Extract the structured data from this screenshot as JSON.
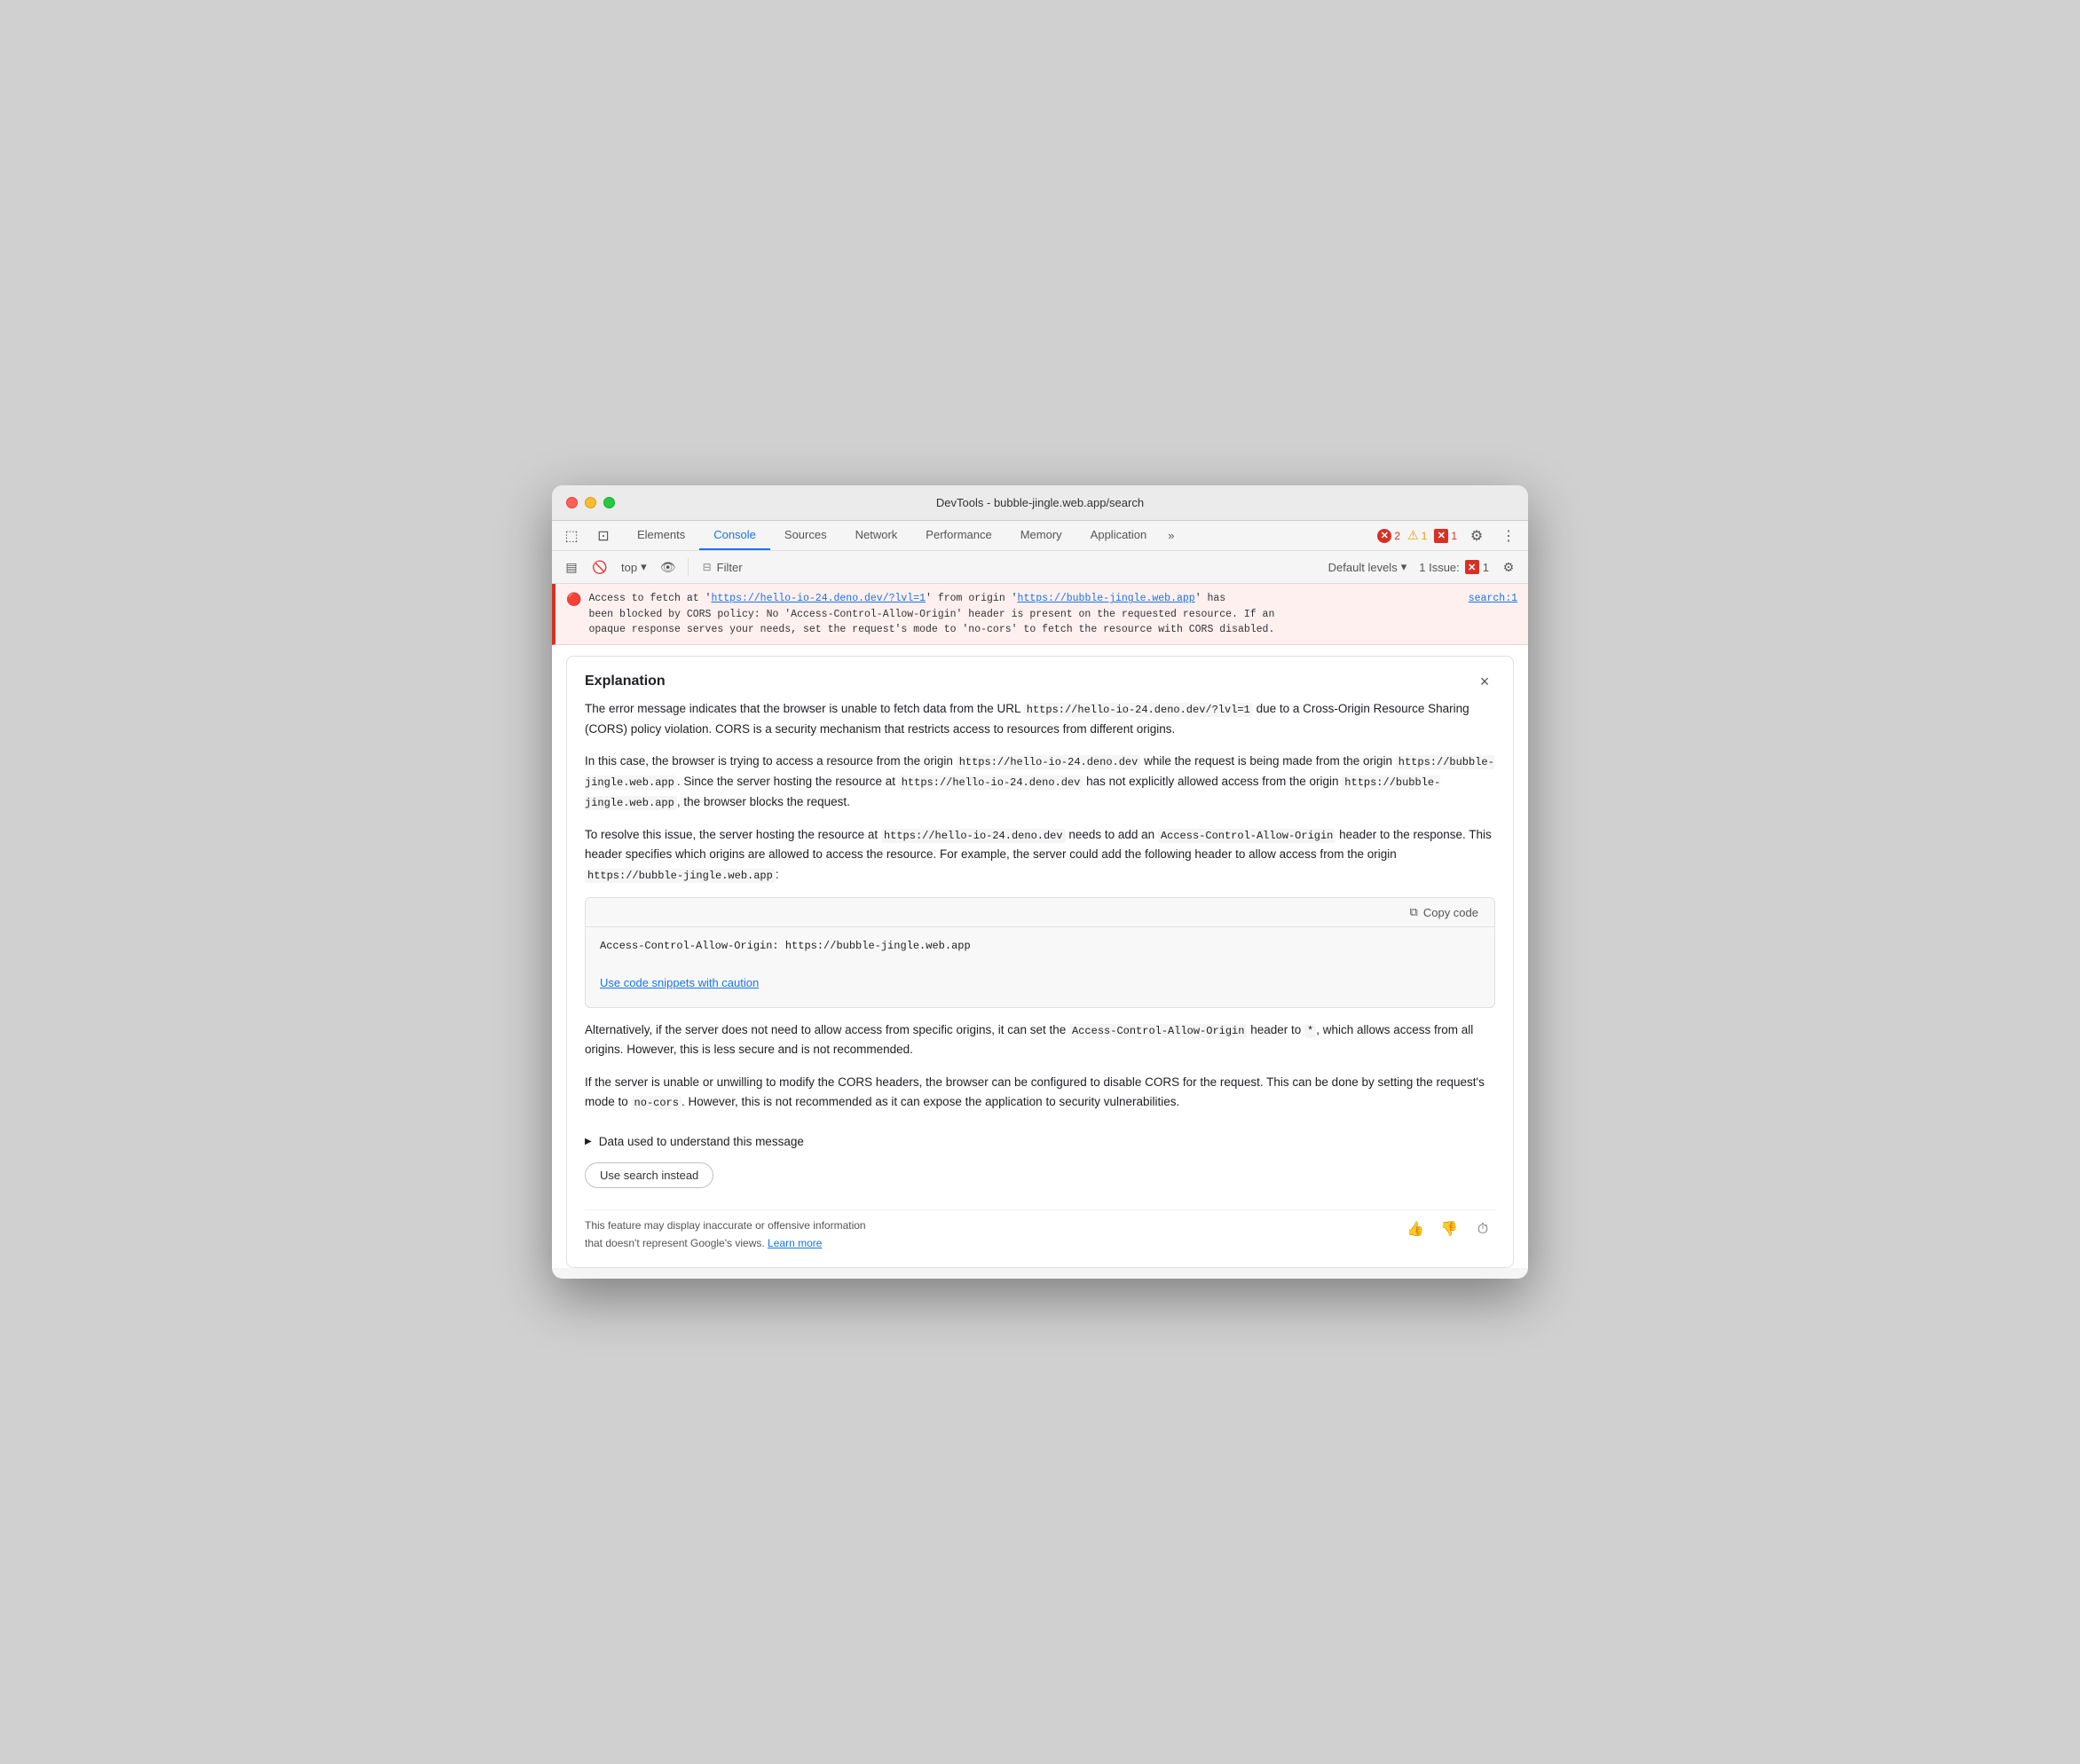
{
  "window": {
    "title": "DevTools - bubble-jingle.web.app/search"
  },
  "tabs": {
    "items": [
      {
        "label": "Elements",
        "active": false
      },
      {
        "label": "Console",
        "active": true
      },
      {
        "label": "Sources",
        "active": false
      },
      {
        "label": "Network",
        "active": false
      },
      {
        "label": "Performance",
        "active": false
      },
      {
        "label": "Memory",
        "active": false
      },
      {
        "label": "Application",
        "active": false
      }
    ],
    "more_label": "»",
    "error_count": "2",
    "warn_count": "1",
    "issue_count": "1"
  },
  "toolbar": {
    "level_label": "Default levels",
    "level_arrow": "▾",
    "top_label": "top",
    "filter_label": "Filter",
    "issues_label": "1 Issue:"
  },
  "console": {
    "error_text_before": "Access to fetch at '",
    "error_url1": "https://hello-io-24.deno.dev/?lvl=1",
    "error_text_mid1": "' from origin '",
    "error_url2": "https://bubble-jingle.web.app",
    "error_text_after": "' has",
    "error_line2": "been blocked by CORS policy: No 'Access-Control-Allow-Origin' header is present on the requested resource. If an",
    "error_line3": "opaque response serves your needs, set the request's mode to 'no-cors' to fetch the resource with CORS disabled.",
    "error_source": "search:1"
  },
  "explanation": {
    "title": "Explanation",
    "body_p1": "The error message indicates that the browser is unable to fetch data from the URL",
    "body_p1_code": "https://hello-io-24.deno.dev/?lvl=1",
    "body_p1_end": "due to a Cross-Origin Resource Sharing (CORS) policy violation. CORS is a security mechanism that restricts access to resources from different origins.",
    "body_p2_start": "In this case, the browser is trying to access a resource from the origin",
    "body_p2_code1": "https://hello-io-24.deno.dev",
    "body_p2_mid": "while the request is being made from the origin",
    "body_p2_code2": "https://bubble-jingle.web.app",
    "body_p2_mid2": ". Since the server hosting the resource at",
    "body_p2_code3": "https://hello-io-24.deno.dev",
    "body_p2_mid3": "has not explicitly allowed access from the origin",
    "body_p2_code4": "https://bubble-jingle.web.app",
    "body_p2_end": ", the browser blocks the request.",
    "body_p3_start": "To resolve this issue, the server hosting the resource at",
    "body_p3_code1": "https://hello-io-24.deno.dev",
    "body_p3_mid": "needs to add an",
    "body_p3_code2": "Access-Control-Allow-Origin",
    "body_p3_mid2": "header to the response. This header specifies which origins are allowed to access the resource. For example, the server could add the following header to allow access from the origin",
    "body_p3_code3": "https://bubble-jingle.web.app",
    "body_p3_end": ":",
    "copy_code_label": "Copy code",
    "code_snippet": "Access-Control-Allow-Origin: https://bubble-jingle.web.app",
    "caution_link": "Use code snippets with caution",
    "body_p4_start": "Alternatively, if the server does not need to allow access from specific origins, it can set the",
    "body_p4_code": "Access-Control-Allow-Origin",
    "body_p4_mid": "header to",
    "body_p4_code2": "*",
    "body_p4_end": ", which allows access from all origins. However, this is less secure and is not recommended.",
    "body_p5_start": "If the server is unable or unwilling to modify the CORS headers, the browser can be configured to disable CORS for the request. This can be done by setting the request's mode to",
    "body_p5_code": "no-cors",
    "body_p5_end": ". However, this is not recommended as it can expose the application to security vulnerabilities.",
    "data_used_label": "Data used to understand this message",
    "use_search_label": "Use search instead",
    "disclaimer": "This feature may display inaccurate or offensive information that doesn't represent Google's views.",
    "learn_more": "Learn more"
  }
}
